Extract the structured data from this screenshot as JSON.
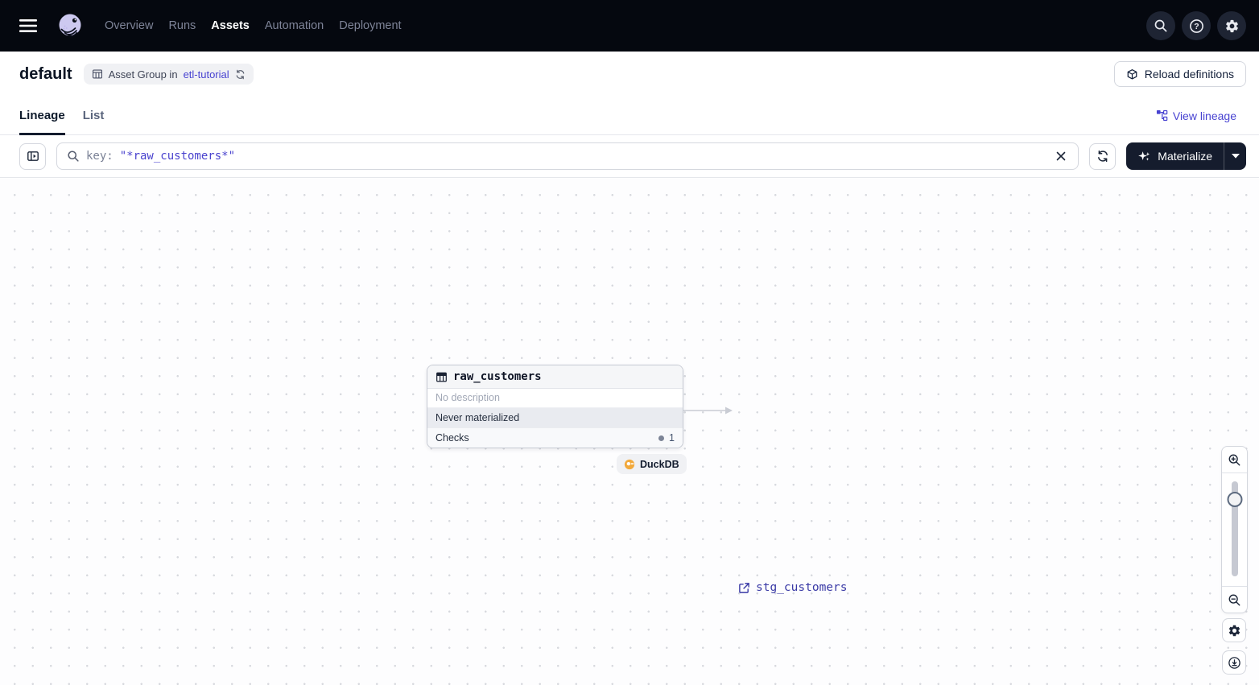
{
  "nav": {
    "menu_icon": "hamburger-icon",
    "logo_icon": "dagster-logo",
    "items": [
      {
        "label": "Overview",
        "active": false
      },
      {
        "label": "Runs",
        "active": false
      },
      {
        "label": "Assets",
        "active": true
      },
      {
        "label": "Automation",
        "active": false
      },
      {
        "label": "Deployment",
        "active": false
      }
    ],
    "right_icons": [
      "search-icon",
      "help-icon",
      "settings-icon"
    ]
  },
  "header": {
    "title": "default",
    "badge": {
      "icon": "asset-group-icon",
      "text": "Asset Group in",
      "link": "etl-tutorial",
      "sync_icon": "sync-icon"
    },
    "reload_button": {
      "icon": "code-location-icon",
      "label": "Reload definitions"
    }
  },
  "tabs": {
    "items": [
      {
        "label": "Lineage",
        "active": true
      },
      {
        "label": "List",
        "active": false
      }
    ],
    "view_lineage": {
      "icon": "lineage-icon",
      "label": "View lineage"
    }
  },
  "toolbar": {
    "panel_toggle_icon": "panel-toggle-icon",
    "filter_field": {
      "icon": "search-icon",
      "prefix": "key:",
      "value": "\"*raw_customers*\"",
      "clear_icon": "close-icon"
    },
    "refresh_icon": "refresh-icon",
    "materialize": {
      "icon": "sparkles-icon",
      "label": "Materialize",
      "caret_icon": "caret-down-icon"
    }
  },
  "graph": {
    "node": {
      "icon": "table-icon",
      "name": "raw_customers",
      "description": "No description",
      "status": "Never materialized",
      "checks": {
        "label": "Checks",
        "count": "1"
      }
    },
    "kind_tag": {
      "icon": "duckdb-icon",
      "label": "DuckDB"
    },
    "downstream": {
      "icon": "external-link-icon",
      "label": "stg_customers"
    }
  },
  "zoom_controls": {
    "icons": [
      "zoom-in-icon",
      "zoom-out-icon",
      "settings-icon",
      "recenter-icon"
    ]
  },
  "colors": {
    "nav_bg": "#05080F",
    "accent_purple": "#4843D1",
    "link_indigo": "#3A3AA6",
    "materialize_bg": "#151C2D",
    "status_row_bg": "#E9EBF0",
    "duckdb_amber": "#F2A93B",
    "border": "#D4D7DE"
  }
}
